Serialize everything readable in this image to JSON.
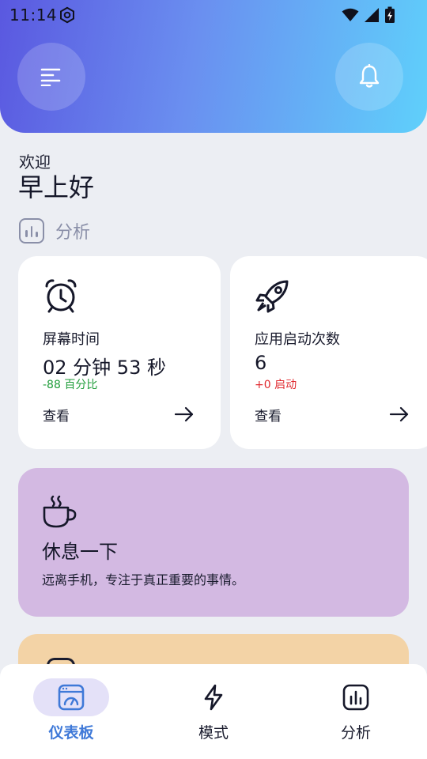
{
  "status_bar": {
    "time": "11:14",
    "icons": [
      "settings-icon",
      "wifi-icon",
      "signal-icon",
      "battery-icon"
    ]
  },
  "header": {
    "menu_icon": "menu-icon",
    "bell_icon": "bell-icon",
    "gradient": [
      "#5a58e0",
      "#5fd0fb"
    ]
  },
  "welcome": {
    "label": "欢迎",
    "greeting": "早上好"
  },
  "analysis_section": {
    "title": "分析",
    "icon": "bar-chart-icon"
  },
  "cards": [
    {
      "icon": "alarm-clock-icon",
      "label": "屏幕时间",
      "value": "02 分钟 53 秒",
      "delta": "-88 百分比",
      "delta_color": "#1f9d3a",
      "link": "查看"
    },
    {
      "icon": "rocket-icon",
      "label": "应用启动次数",
      "value": "6",
      "delta": "+0 启动",
      "delta_color": "#e0282e",
      "link": "查看"
    }
  ],
  "break_card": {
    "icon": "coffee-cup-icon",
    "title": "休息一下",
    "description": "远离手机，专注于真正重要的事情。",
    "color": "#d3b9e2"
  },
  "next_card": {
    "color": "#f3d3a6"
  },
  "bottom_nav": {
    "items": [
      {
        "label": "仪表板",
        "icon": "dashboard-icon",
        "active": true
      },
      {
        "label": "模式",
        "icon": "lightning-icon",
        "active": false
      },
      {
        "label": "分析",
        "icon": "bar-chart-icon",
        "active": false
      }
    ],
    "accent": "#3f79d8"
  }
}
